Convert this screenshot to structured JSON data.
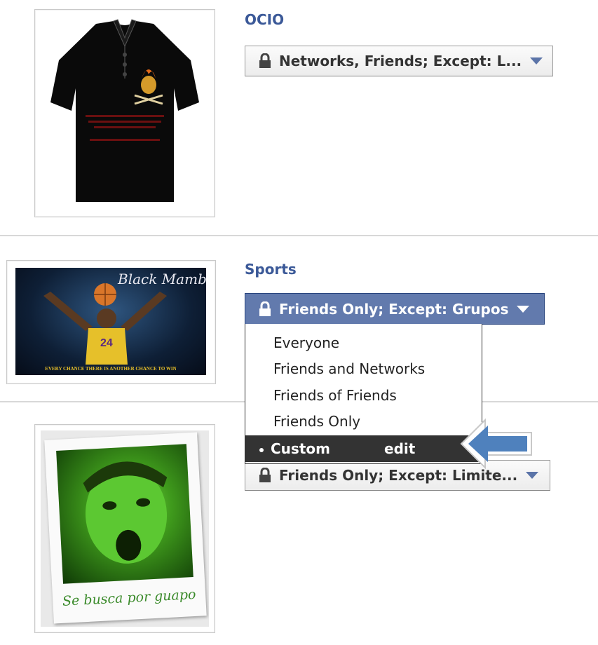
{
  "albums": [
    {
      "title": "OCIO",
      "privacy": "Networks, Friends; Except: L..."
    },
    {
      "title": "Sports",
      "privacy": "Friends Only; Except: Grupos",
      "thumb_caption_script": "Black Mamba",
      "thumb_caption": "EVERY CHANCE THERE IS ANOTHER CHANCE TO WIN",
      "jersey_number": "24"
    },
    {
      "title": "",
      "privacy": "Friends Only; Except: Limite...",
      "thumb_caption": "Se busca por guapo"
    }
  ],
  "dropdown": {
    "options": [
      "Everyone",
      "Friends and Networks",
      "Friends of Friends",
      "Friends Only"
    ],
    "selected": "Custom",
    "edit": "edit"
  },
  "colors": {
    "link": "#3b5998",
    "active_button": "#627aad",
    "menu_selected": "#333333",
    "arrow": "#4f81bd"
  }
}
